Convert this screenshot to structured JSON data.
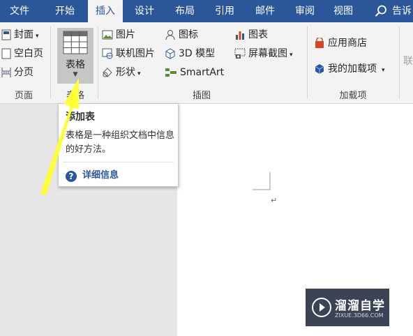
{
  "tabs": [
    {
      "label": "文件",
      "active": false
    },
    {
      "label": "开始",
      "active": false
    },
    {
      "label": "插入",
      "active": true
    },
    {
      "label": "设计",
      "active": false
    },
    {
      "label": "布局",
      "active": false
    },
    {
      "label": "引用",
      "active": false
    },
    {
      "label": "邮件",
      "active": false
    },
    {
      "label": "审阅",
      "active": false
    },
    {
      "label": "视图",
      "active": false
    }
  ],
  "tell_me": "告诉",
  "ribbon": {
    "pages": {
      "cover": "封面",
      "blank": "空白页",
      "break": "分页",
      "label": "页面"
    },
    "tables": {
      "table": "表格",
      "label": "表格"
    },
    "illustrations": {
      "picture": "图片",
      "online_picture": "联机图片",
      "shapes": "形状",
      "icons": "图标",
      "model3d": "3D 模型",
      "smartart": "SmartArt",
      "chart": "图表",
      "screenshot": "屏幕截图",
      "label": "插图"
    },
    "addins": {
      "store": "应用商店",
      "my_addins": "我的加载项",
      "label": "加载项"
    },
    "cutoff": "联"
  },
  "tooltip": {
    "title": "添加表",
    "description": "表格是一种组织文档中信息的好方法。",
    "help": "详细信息"
  },
  "watermark": {
    "title": "溜溜自学",
    "subtitle": "ZIXUE.3D66.COM"
  },
  "colors": {
    "accent": "#2b579a",
    "annotation_arrow": "#ffff33"
  }
}
